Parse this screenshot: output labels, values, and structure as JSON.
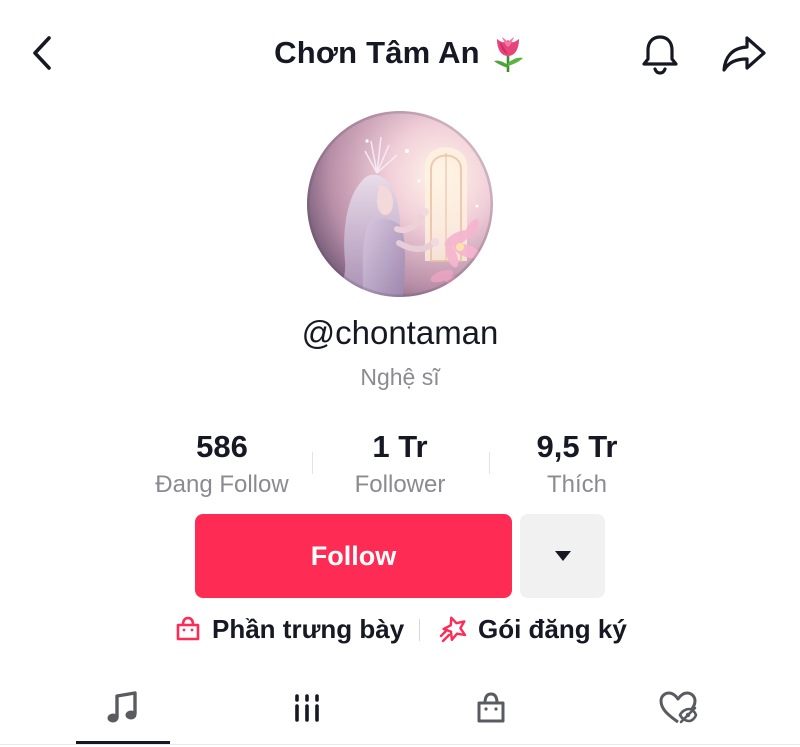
{
  "header": {
    "title": "Chơn Tâm An",
    "title_emoji": "tulip-emoji",
    "icons": [
      "back-chevron-icon",
      "bell-icon",
      "share-arrow-icon"
    ]
  },
  "profile": {
    "avatar": "avatar-fantasy-woman-illustration",
    "username": "@chontaman",
    "role": "Nghệ sĩ"
  },
  "stats": [
    {
      "value": "586",
      "label": "Đang Follow"
    },
    {
      "value": "1 Tr",
      "label": "Follower"
    },
    {
      "value": "9,5 Tr",
      "label": "Thích"
    }
  ],
  "actions": {
    "follow_label": "Follow",
    "more_icon": "caret-down-icon"
  },
  "links": {
    "showcase_label": "Phần trưng bày",
    "subscription_label": "Gói đăng ký"
  },
  "tabs": [
    {
      "icon": "music-note-icon",
      "active": true
    },
    {
      "icon": "grid-bars-icon",
      "active": false
    },
    {
      "icon": "shopping-bag-icon",
      "active": false
    },
    {
      "icon": "liked-hidden-heart-icon",
      "active": false
    }
  ],
  "colors": {
    "accent": "#fe2c55",
    "text_primary": "#161823",
    "text_secondary": "#8a8b91",
    "button_secondary_bg": "#f1f1f2"
  }
}
